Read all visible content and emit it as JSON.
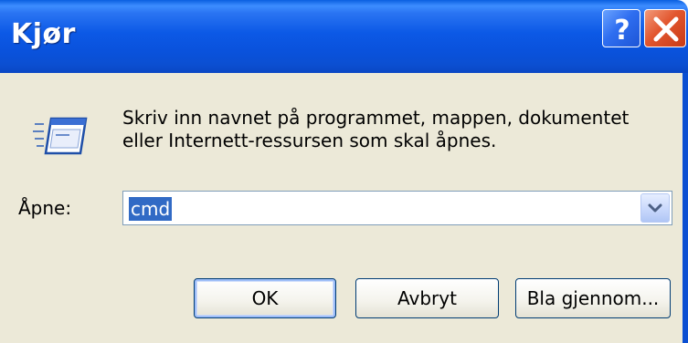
{
  "window": {
    "title": "Kjør",
    "help_symbol": "?",
    "close_symbol": "✕"
  },
  "icons": {
    "run": "run-window-icon",
    "help": "help-icon",
    "close": "close-icon",
    "dropdown": "chevron-down-icon"
  },
  "dialog": {
    "description_line1": "Skriv inn navnet på programmet, mappen, dokumentet",
    "description_line2": "eller Internett-ressursen som skal åpnes.",
    "open_label": "Åpne:",
    "open_value": "cmd"
  },
  "buttons": {
    "ok_label": "OK",
    "cancel_label": "Avbryt",
    "browse_label": "Bla gjennom..."
  },
  "colors": {
    "titlebar": "#0b4fd2",
    "close_button": "#e2562e",
    "selection": "#316ac5",
    "client": "#ece9d8"
  }
}
